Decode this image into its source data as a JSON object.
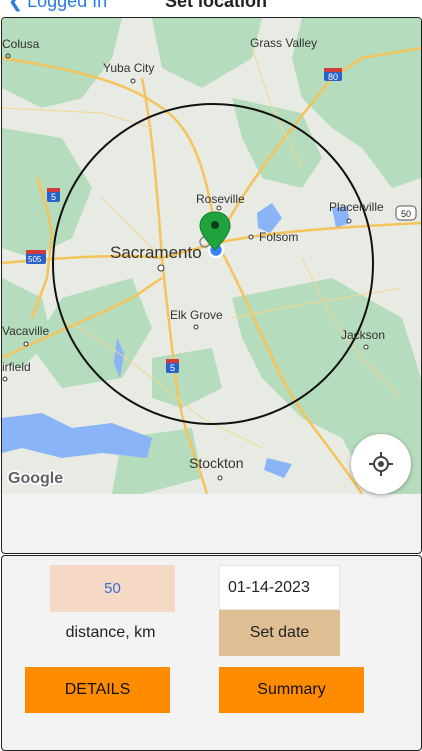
{
  "nav": {
    "back_label": "Logged In",
    "title": "Set location"
  },
  "map": {
    "places": {
      "colusa": "Colusa",
      "grass_valley": "Grass Valley",
      "yuba_city": "Yuba City",
      "roseville": "Roseville",
      "placerville": "Placerville",
      "sacramento": "Sacramento",
      "folsom": "Folsom",
      "elk_grove": "Elk Grove",
      "jackson": "Jackson",
      "vacaville": "Vacaville",
      "fairfield": "irfield",
      "stockton": "Stockton"
    },
    "shields": {
      "i80": "80",
      "i5_north": "5",
      "i505": "505",
      "i5_south": "5",
      "us50": "50"
    },
    "attribution": "Google",
    "colors": {
      "land": "#e8ebe3",
      "park": "#b5dcbc",
      "water": "#8ab4f8",
      "road": "#f5c35b",
      "pin": "#1fa33c",
      "user_dot": "#3b82f6"
    }
  },
  "controls": {
    "distance_value": "50",
    "distance_label": "distance, km",
    "date_value": "01-14-2023",
    "set_date_label": "Set date",
    "details_label": "DETAILS",
    "summary_label": "Summary"
  }
}
